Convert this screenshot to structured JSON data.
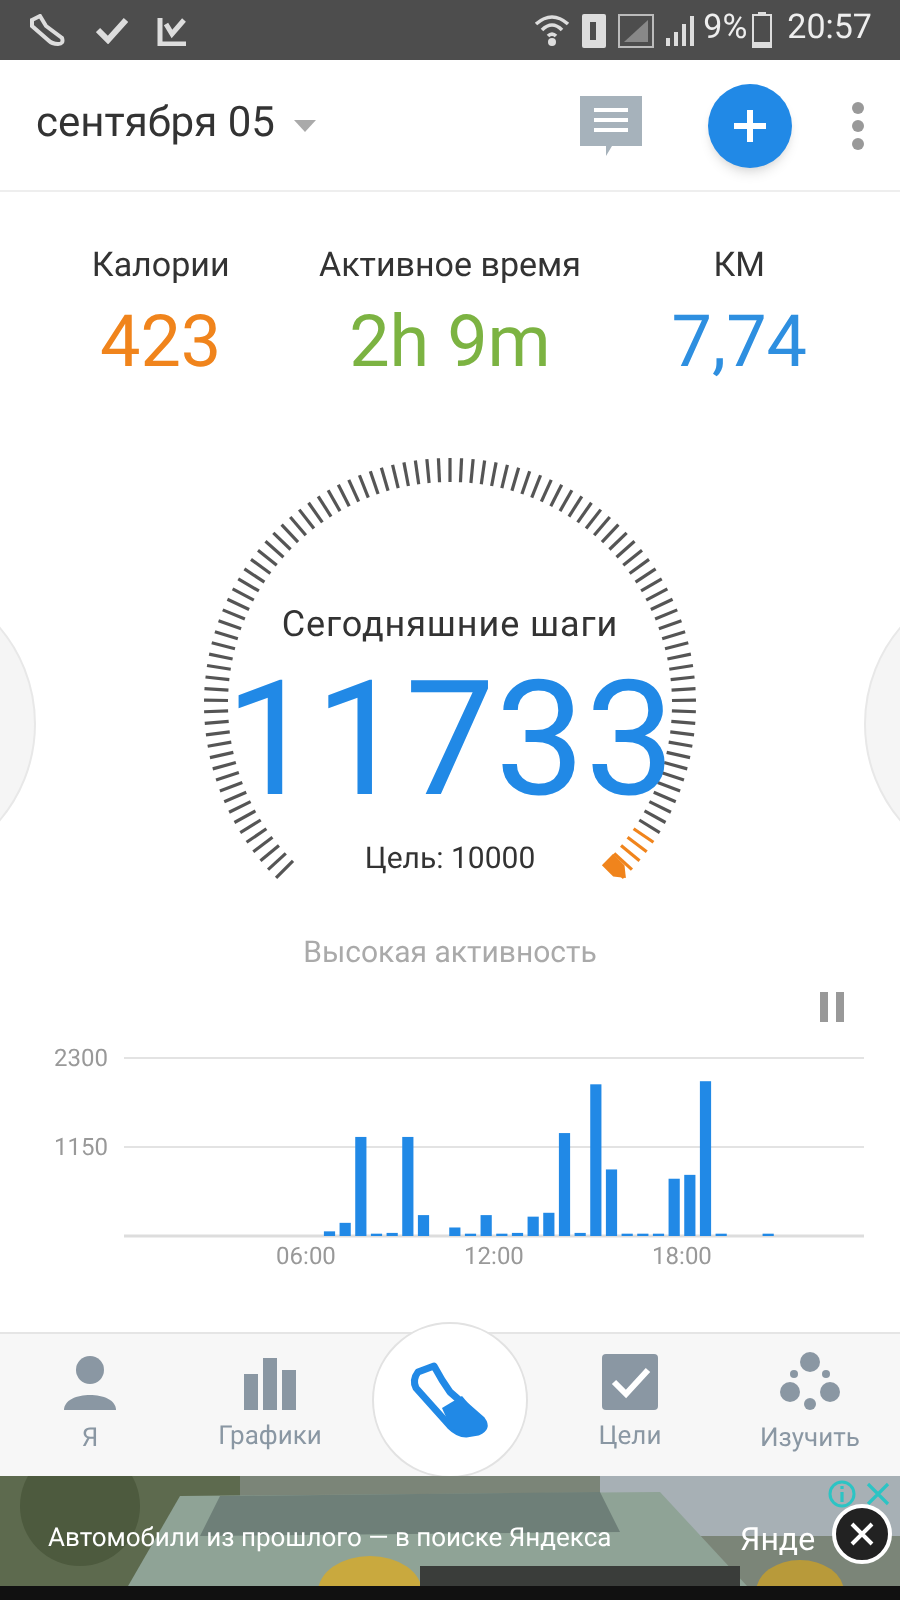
{
  "status_bar": {
    "battery": "9%",
    "time": "20:57"
  },
  "header": {
    "date": "сентября 05"
  },
  "stats": [
    {
      "label": "Калории",
      "value": "423",
      "color": "#f0841c"
    },
    {
      "label": "Активное время",
      "value": "2h 9m",
      "color": "#7cb342"
    },
    {
      "label": "КМ",
      "value": "7,74",
      "color": "#2e8fe0"
    }
  ],
  "gauge": {
    "title": "Сегодняшние шаги",
    "steps": "11733",
    "goal": "Цель: 10000",
    "activity": "Высокая активность"
  },
  "chart": {
    "chart_data": {
      "type": "bar",
      "x": [
        6.75,
        7.25,
        7.75,
        8.25,
        8.75,
        9.25,
        9.75,
        10.75,
        11.25,
        11.75,
        12.25,
        12.75,
        13.25,
        13.75,
        14.25,
        14.75,
        15.25,
        15.75,
        16.25,
        16.75,
        17.25,
        17.75,
        18.25,
        18.75,
        19.25,
        20.75
      ],
      "series": [
        {
          "color": "#2189e6",
          "values": [
            60,
            170,
            1280,
            30,
            40,
            1280,
            270,
            110,
            30,
            270,
            30,
            40,
            250,
            300,
            1330,
            40,
            1960,
            860,
            30,
            30,
            30,
            740,
            790,
            2000,
            30,
            30
          ]
        }
      ],
      "xlim": [
        0,
        24
      ],
      "ylim": [
        0,
        2300
      ],
      "yticks": [
        1150,
        2300
      ],
      "xticks": [
        {
          "value": 6,
          "label": "06:00"
        },
        {
          "value": 12,
          "label": "12:00"
        },
        {
          "value": 18,
          "label": "18:00"
        }
      ]
    }
  },
  "nav": [
    {
      "label": "Я",
      "kind": "person",
      "selected": false
    },
    {
      "label": "Графики",
      "kind": "bars",
      "selected": false
    },
    {
      "kind": "shoe",
      "selected": true
    },
    {
      "label": "Цели",
      "kind": "check",
      "selected": false
    },
    {
      "label": "Изучить",
      "kind": "learn",
      "selected": false
    }
  ],
  "ad": {
    "text": "Автомобили из прошлого — в поиске Яндекса",
    "brand": "Янде"
  }
}
